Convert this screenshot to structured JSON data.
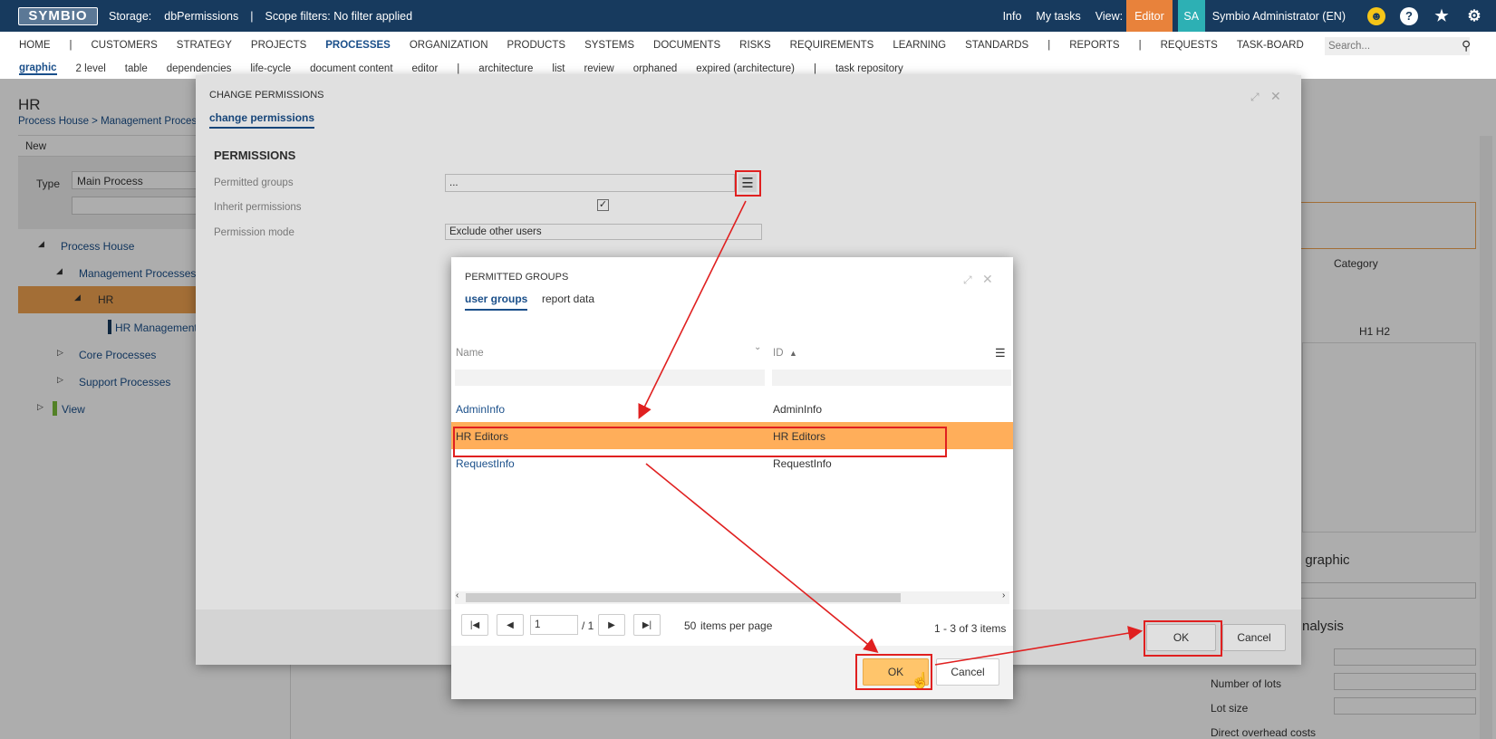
{
  "topbar": {
    "logo": "SYMBIO",
    "storage_label": "Storage:",
    "storage_value": "dbPermissions",
    "sep": "|",
    "scope": "Scope filters: No filter applied",
    "info": "Info",
    "my_tasks": "My tasks",
    "view_label": "View:",
    "view_value": "Editor",
    "avatar": "SA",
    "user": "Symbio Administrator (EN)"
  },
  "nav1": {
    "items": [
      "HOME",
      "|",
      "CUSTOMERS",
      "STRATEGY",
      "PROJECTS",
      "PROCESSES",
      "ORGANIZATION",
      "PRODUCTS",
      "SYSTEMS",
      "DOCUMENTS",
      "RISKS",
      "REQUIREMENTS",
      "LEARNING",
      "STANDARDS",
      "|",
      "REPORTS",
      "|",
      "REQUESTS",
      "TASK-BOARD"
    ],
    "active": "PROCESSES",
    "search_placeholder": "Search..."
  },
  "nav2": {
    "items": [
      "graphic",
      "2 level",
      "table",
      "dependencies",
      "life-cycle",
      "document content",
      "editor",
      "|",
      "architecture",
      "list",
      "review",
      "orphaned",
      "expired (architecture)",
      "|",
      "task repository"
    ],
    "active": "graphic"
  },
  "page": {
    "title": "HR",
    "breadcrumb": "Process House  >  Management Proces",
    "new": "New",
    "type_label": "Type",
    "type_value": "Main Process",
    "tree": [
      "Process House",
      "Management Processes",
      "HR",
      "HR Management",
      "Core Processes",
      "Support Processes",
      "View"
    ],
    "right": {
      "category": "Category",
      "graphic": "t graphic",
      "analysis": "nalysis",
      "lots": "Number of lots",
      "lot_size": "Lot size",
      "overhead": "Direct overhead costs",
      "rte": "H1  H2"
    }
  },
  "dialog1": {
    "title": "CHANGE PERMISSIONS",
    "tab": "change permissions",
    "section": "PERMISSIONS",
    "fields": [
      {
        "label": "Permitted groups",
        "value": "..."
      },
      {
        "label": "Inherit permissions",
        "value": ""
      },
      {
        "label": "Permission mode",
        "value": "Exclude other users"
      }
    ],
    "ok": "OK",
    "cancel": "Cancel"
  },
  "dialog2": {
    "title": "PERMITTED GROUPS",
    "tabs": [
      "user groups",
      "report data"
    ],
    "columns": [
      "Name",
      "ID"
    ],
    "rows": [
      {
        "name": "AdminInfo",
        "id": "AdminInfo",
        "selected": false
      },
      {
        "name": "HR Editors",
        "id": "HR Editors",
        "selected": true
      },
      {
        "name": "RequestInfo",
        "id": "RequestInfo",
        "selected": false
      }
    ],
    "page": "1",
    "of": "/ 1",
    "per_page": "50",
    "per_page_label": "items per page",
    "summary": "1 - 3 of 3 items",
    "ok": "OK",
    "cancel": "Cancel"
  },
  "colors": {
    "topbar": "#173a5e",
    "accent": "#e8823b",
    "selected_row": "#ffae5a",
    "link": "#1a4f8a",
    "annotation": "#e02020"
  }
}
